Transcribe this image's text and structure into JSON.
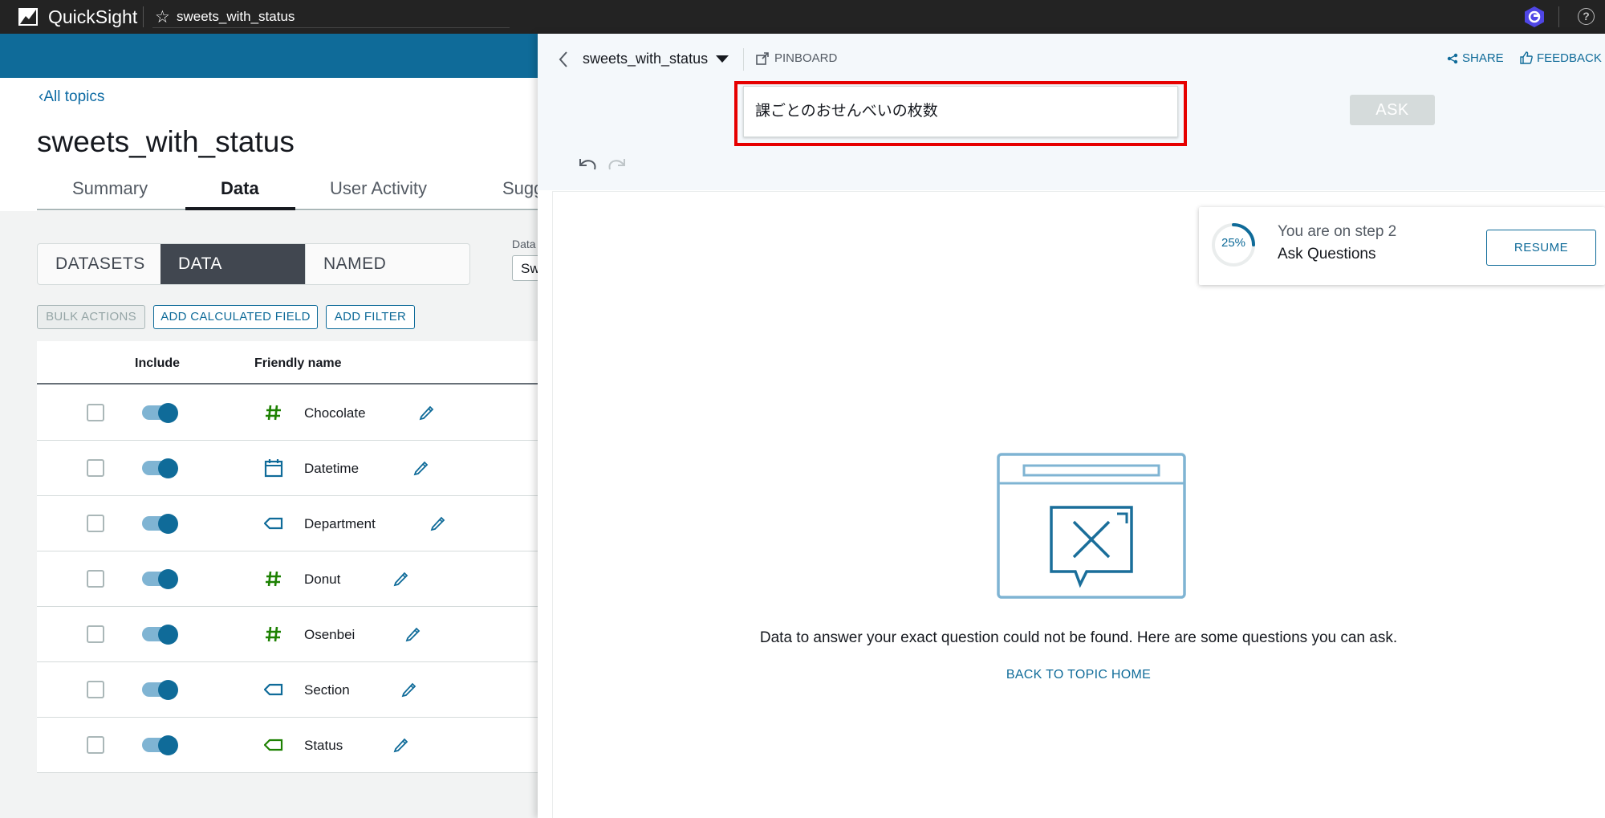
{
  "topbar": {
    "app_name": "QuickSight",
    "analysis_name": "sweets_with_status"
  },
  "left": {
    "back_link": "All topics",
    "topic_title": "sweets_with_status",
    "tabs": [
      "Summary",
      "Data",
      "User Activity",
      "Sugg"
    ],
    "active_tab": "Data",
    "segments": [
      "DATASETS",
      "DATA FIELDS",
      "NAMED ENTITY"
    ],
    "active_segment": "DATA FIELDS",
    "dataset_label": "Data",
    "dataset_value": "Sw",
    "buttons": {
      "bulk": "BULK ACTIONS",
      "calc": "ADD CALCULATED FIELD",
      "filter": "ADD FILTER"
    },
    "table": {
      "headers": {
        "include": "Include",
        "friendly_name": "Friendly name"
      },
      "rows": [
        {
          "name": "Chocolate",
          "type": "measure",
          "icon": "hash-icon"
        },
        {
          "name": "Datetime",
          "type": "date",
          "icon": "calendar-icon"
        },
        {
          "name": "Department",
          "type": "dimension",
          "icon": "tag-icon"
        },
        {
          "name": "Donut",
          "type": "measure",
          "icon": "hash-icon"
        },
        {
          "name": "Osenbei",
          "type": "measure",
          "icon": "hash-icon"
        },
        {
          "name": "Section",
          "type": "dimension",
          "icon": "tag-icon"
        },
        {
          "name": "Status",
          "type": "dimension-green",
          "icon": "tag-icon"
        }
      ]
    }
  },
  "right": {
    "topic_select": "sweets_with_status",
    "pinboard": "PINBOARD",
    "share": "SHARE",
    "feedback": "FEEDBACK",
    "question": "課ごとのおせんべいの枚数",
    "ask_button": "ASK",
    "step": {
      "percent": "25%",
      "progress": 0.25,
      "text": "You are on step 2",
      "subtitle": "Ask Questions",
      "resume": "RESUME"
    },
    "message": "Data to answer your exact question could not be found. Here are some questions you can ask.",
    "back_to_topic": "BACK TO TOPIC HOME"
  },
  "colors": {
    "accent": "#0f6b99",
    "band": "#0f6b99",
    "highlight": "#e60000",
    "measure_icon": "#1d8102",
    "date_icon": "#0f6b99",
    "dim_icon": "#0f6b99",
    "status_icon": "#1d8102"
  }
}
